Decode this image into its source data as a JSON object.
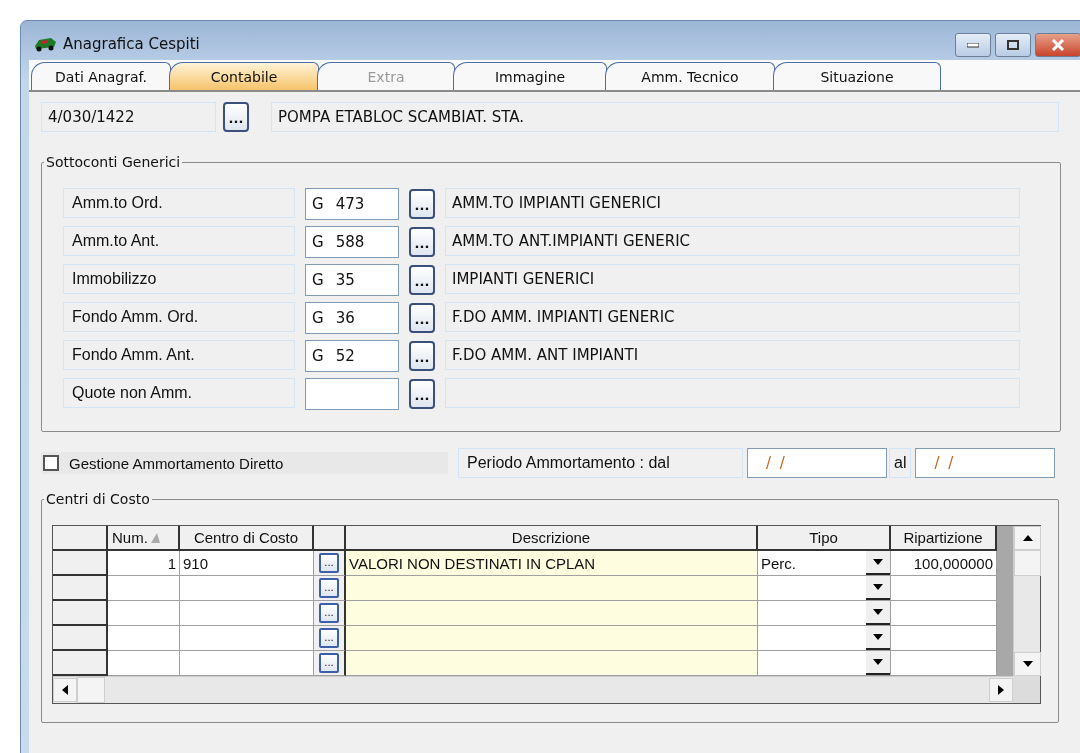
{
  "window": {
    "title": "Anagrafica Cespiti"
  },
  "tabs": [
    {
      "label": "Dati Anagraf.",
      "selected": false,
      "disabled": false
    },
    {
      "label": "Contabile",
      "selected": true,
      "disabled": false
    },
    {
      "label": "Extra",
      "selected": false,
      "disabled": true
    },
    {
      "label": "Immagine",
      "selected": false,
      "disabled": false
    },
    {
      "label": "Amm. Tecnico",
      "selected": false,
      "disabled": false
    },
    {
      "label": "Situazione",
      "selected": false,
      "disabled": false
    }
  ],
  "asset": {
    "code": "4/030/1422",
    "button": "...",
    "description": "POMPA ETABLOC SCAMBIAT. STA."
  },
  "sottoconti": {
    "title": "Sottoconti Generici",
    "rows": [
      {
        "label": "Amm.to Ord.",
        "type": "G",
        "number": "473",
        "button": "...",
        "description": "AMM.TO IMPIANTI GENERICI"
      },
      {
        "label": "Amm.to Ant.",
        "type": "G",
        "number": "588",
        "button": "...",
        "description": "AMM.TO ANT.IMPIANTI GENERIC"
      },
      {
        "label": "Immobilizzo",
        "type": "G",
        "number": "35",
        "button": "...",
        "description": "IMPIANTI GENERICI"
      },
      {
        "label": "Fondo Amm. Ord.",
        "type": "G",
        "number": "36",
        "button": "...",
        "description": "F.DO AMM. IMPIANTI GENERIC"
      },
      {
        "label": "Fondo Amm. Ant.",
        "type": "G",
        "number": "52",
        "button": "...",
        "description": "F.DO AMM. ANT IMPIANTI"
      },
      {
        "label": "Quote non Amm.",
        "button": "..."
      }
    ]
  },
  "gestione": {
    "label": "Gestione Ammortamento Diretto",
    "checked": false
  },
  "periodo": {
    "label": "Periodo Ammortamento : dal",
    "from": "/  /",
    "to_label": "al",
    "to": "/  /"
  },
  "centri": {
    "title": "Centri di Costo",
    "columns": [
      "Num.",
      "Centro di Costo",
      "Descrizione",
      "Tipo",
      "Ripartizione"
    ],
    "rows": [
      {
        "num": "1",
        "centro": "910",
        "button": "...",
        "descrizione": "VALORI NON DESTINATI IN CPLAN",
        "tipo": "Perc.",
        "ripartizione": "100,000000"
      },
      {
        "button": "..."
      },
      {
        "button": "..."
      },
      {
        "button": "..."
      },
      {
        "button": "..."
      }
    ]
  }
}
